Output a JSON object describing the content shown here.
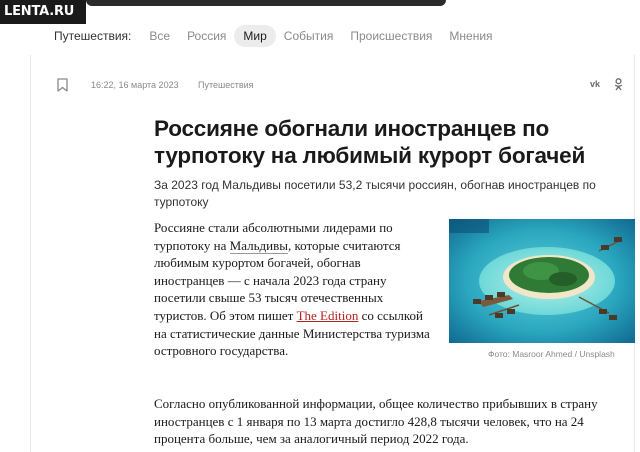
{
  "header": {
    "logo": "LENTA.RU"
  },
  "nav": {
    "label": "Путешествия:",
    "items": [
      {
        "label": "Все",
        "active": false
      },
      {
        "label": "Россия",
        "active": false
      },
      {
        "label": "Мир",
        "active": true
      },
      {
        "label": "События",
        "active": false
      },
      {
        "label": "Происшествия",
        "active": false
      },
      {
        "label": "Мнения",
        "active": false
      }
    ]
  },
  "meta": {
    "time": "16:22, 16 марта 2023",
    "rubric": "Путешествия",
    "share": {
      "vk": "vk",
      "ok": "ок"
    }
  },
  "article": {
    "title": "Россияне обогнали иностранцев по турпотоку на любимый курорт богачей",
    "subtitle": "За 2023 год Мальдивы посетили 53,2 тысячи россиян, обогнав иностранцев по турпотоку",
    "p1": {
      "part1": "Россияне стали абсолютными лидерами по турпотоку на ",
      "link1": "Мальдивы",
      "part2": ", которые считаются любимым курортом богачей, обогнав иностранцев — с начала 2023 года страну посетили свыше 53 тысяч отечественных туристов. Об этом пишет ",
      "link2": "The Edition",
      "part3": " со ссылкой на статистические данные Министерства туризма островного государства."
    },
    "p2": "Согласно опубликованной информации, общее количество прибывших в страну иностранцев с 1 января по 13 марта достигло 428,8 тысячи человек, что на 24 процента больше, чем за аналогичный период 2022 года.",
    "photo": {
      "caption": "Фото: Masroor Ahmed / Unsplash"
    }
  }
}
